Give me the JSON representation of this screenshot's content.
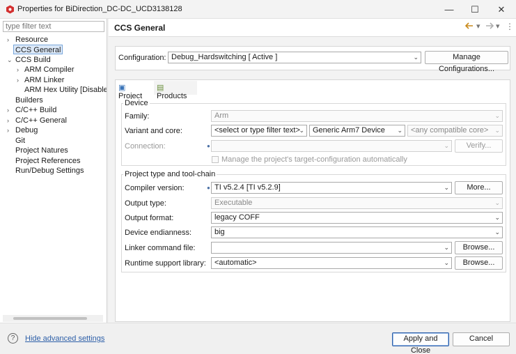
{
  "window": {
    "title": "Properties for BiDirection_DC-DC_UCD3138128",
    "minimize": "—",
    "maximize": "☐",
    "close": "✕"
  },
  "sidebar": {
    "filter_placeholder": "type filter text",
    "items": [
      {
        "label": "Resource",
        "arrow": "›"
      },
      {
        "label": "CCS General",
        "arrow": ""
      },
      {
        "label": "CCS Build",
        "arrow": "⌄"
      },
      {
        "label": "ARM Compiler",
        "arrow": "›"
      },
      {
        "label": "ARM Linker",
        "arrow": "›"
      },
      {
        "label": "ARM Hex Utility  [Disable",
        "arrow": ""
      },
      {
        "label": "Builders",
        "arrow": ""
      },
      {
        "label": "C/C++ Build",
        "arrow": "›"
      },
      {
        "label": "C/C++ General",
        "arrow": "›"
      },
      {
        "label": "Debug",
        "arrow": "›"
      },
      {
        "label": "Git",
        "arrow": ""
      },
      {
        "label": "Project Natures",
        "arrow": ""
      },
      {
        "label": "Project References",
        "arrow": ""
      },
      {
        "label": "Run/Debug Settings",
        "arrow": ""
      }
    ]
  },
  "header": {
    "title": "CCS General"
  },
  "configuration": {
    "label": "Configuration:",
    "value": "Debug_Hardswitching  [ Active ]",
    "manage_button": "Manage Configurations..."
  },
  "tabs": [
    {
      "label": "Project"
    },
    {
      "label": "Products"
    }
  ],
  "device": {
    "group_title": "Device",
    "family_label": "Family:",
    "family_value": "Arm",
    "variant_label": "Variant and core:",
    "variant_filter": "<select or type filter text>",
    "variant_value": "Generic Arm7 Device",
    "core_value": "<any compatible core>",
    "connection_label": "Connection:",
    "connection_value": "",
    "verify_button": "Verify...",
    "manage_checkbox_label": "Manage the project's target-configuration automatically"
  },
  "toolchain": {
    "group_title": "Project type and tool-chain",
    "compiler_label": "Compiler version:",
    "compiler_value": "TI v5.2.4  [TI v5.2.9]",
    "more_button": "More...",
    "output_type_label": "Output type:",
    "output_type_value": "Executable",
    "output_format_label": "Output format:",
    "output_format_value": "legacy COFF",
    "endianness_label": "Device endianness:",
    "endianness_value": "big",
    "linker_label": "Linker command file:",
    "linker_value": "",
    "browse_button": "Browse...",
    "runtime_label": "Runtime support library:",
    "runtime_value": "<automatic>"
  },
  "footer": {
    "help_icon": "?",
    "hide_advanced": "Hide advanced settings",
    "apply_close": "Apply and Close",
    "cancel": "Cancel"
  },
  "colors": {
    "accent": "#2d5fa8",
    "selection": "#dbe8f8",
    "app_icon": "#d32f2f"
  }
}
